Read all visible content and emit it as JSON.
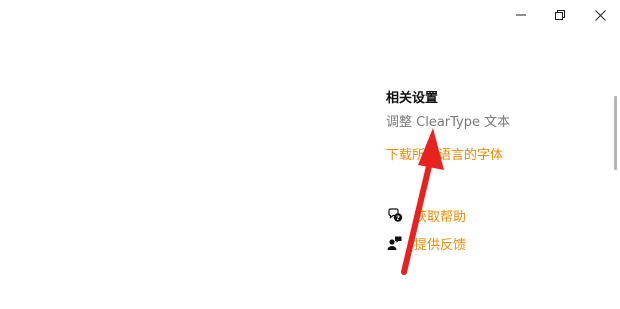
{
  "window_controls": {
    "minimize_icon": "minimize-icon",
    "maximize_icon": "restore-icon",
    "close_icon": "close-icon"
  },
  "related_settings": {
    "title": "相关设置",
    "cleartype_link": "调整 ClearType 文本",
    "download_fonts_link": "下载所有语言的字体"
  },
  "help": {
    "get_help": "获取帮助",
    "feedback": "提供反馈"
  },
  "colors": {
    "accent": "#ef8a00",
    "disabled": "#7a7a7a",
    "annotation_arrow": "#e8231f"
  }
}
